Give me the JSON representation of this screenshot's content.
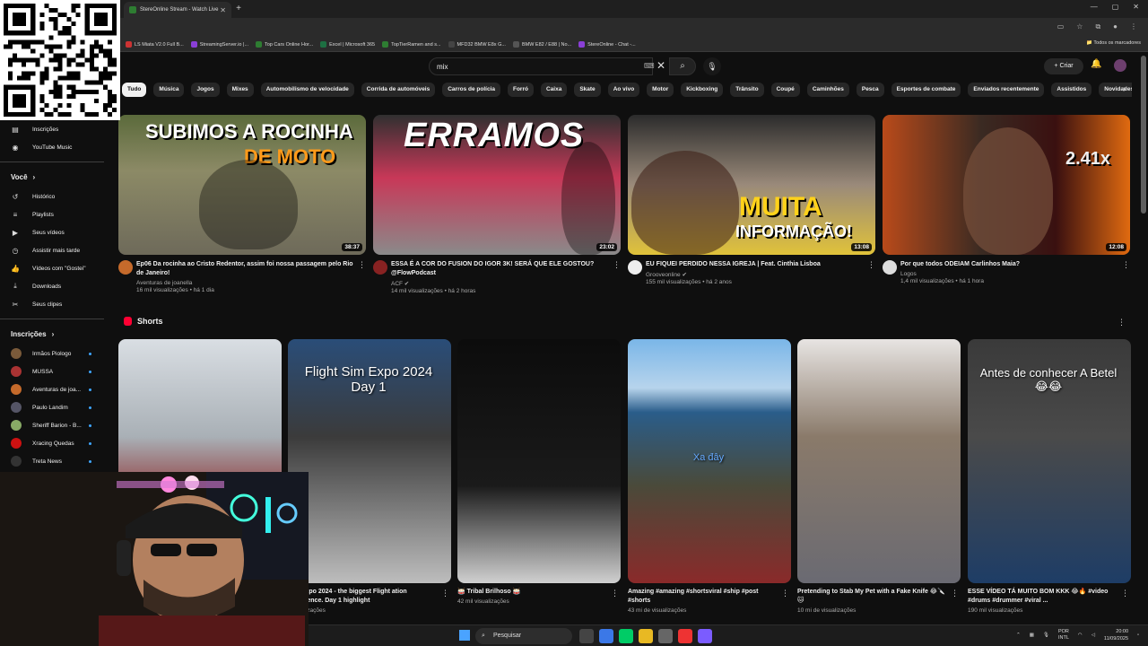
{
  "browser": {
    "tab_title": "StereOnline Stream - Watch Live",
    "bookmarks": [
      "LS Miata V2.0 Full B...",
      "StreamingServer.io |...",
      "Top Cars Online Hor...",
      "Excel | Microsoft 365",
      "TopTierRamen and s...",
      "MFD32 BMW E8x G...",
      "BMW E82 / E88 | No...",
      "StereOnline - Chat -..."
    ],
    "bookmarks_folder": "Todos os marcadores"
  },
  "header": {
    "search_value": "mix",
    "create_label": "Criar"
  },
  "chips": [
    "Tudo",
    "Música",
    "Jogos",
    "Mixes",
    "Automobilismo de velocidade",
    "Corrida de automóveis",
    "Carros de polícia",
    "Forró",
    "Caixa",
    "Skate",
    "Ao vivo",
    "Motor",
    "Kickboxing",
    "Trânsito",
    "Coupé",
    "Caminhões",
    "Pesca",
    "Esportes de combate",
    "Enviados recentemente",
    "Assistidos",
    "Novidades para vo"
  ],
  "sidebar": {
    "top": [
      {
        "icon": "subscriptions-icon",
        "label": "Inscrições"
      },
      {
        "icon": "youtube-music-icon",
        "label": "YouTube Music"
      }
    ],
    "you_heading": "Você",
    "you_items": [
      {
        "icon": "history-icon",
        "label": "Histórico"
      },
      {
        "icon": "playlists-icon",
        "label": "Playlists"
      },
      {
        "icon": "your-videos-icon",
        "label": "Seus vídeos"
      },
      {
        "icon": "watch-later-icon",
        "label": "Assistir mais tarde"
      },
      {
        "icon": "liked-videos-icon",
        "label": "Vídeos com \"Gostei\""
      },
      {
        "icon": "downloads-icon",
        "label": "Downloads"
      },
      {
        "icon": "clips-icon",
        "label": "Seus clipes"
      }
    ],
    "subs_heading": "Inscrições",
    "subs": [
      {
        "label": "Irmãos Piologo",
        "color": "#7a5a3a"
      },
      {
        "label": "MUSSA",
        "color": "#a33"
      },
      {
        "label": "Aventuras de joa...",
        "color": "#c56a2b"
      },
      {
        "label": "Paulo Landim",
        "color": "#556"
      },
      {
        "label": "Sheriff Barion - B...",
        "color": "#8a6"
      },
      {
        "label": "Xracing Quedas",
        "color": "#c11"
      },
      {
        "label": "Treta News",
        "color": "#333"
      }
    ]
  },
  "videos": [
    {
      "thumb_text": "SUBIMOS A ROCINHA",
      "thumb_text2": "DE MOTO",
      "duration": "38:37",
      "title": "Ep06 Da rocinha ao Cristo Redentor, assim foi nossa passagem pelo Rio de Janeiro!",
      "channel": "Aventuras de joanella",
      "stats": "16 mil visualizações • há 1 dia",
      "avatar": "#c56a2b"
    },
    {
      "thumb_text": "ERRAMOS",
      "thumb_text2": "",
      "duration": "23:02",
      "title": "ESSA É A COR DO FUSION DO IGOR 3K! SERÁ QUE ELE GOSTOU? @FlowPodcast",
      "channel": "ACF ✔",
      "stats": "14 mil visualizações • há 2 horas",
      "avatar": "#822"
    },
    {
      "thumb_text": "MUITA",
      "thumb_text2": "INFORMAÇÃO!",
      "duration": "13:08",
      "title": "EU FIQUEI PERDIDO NESSA IGREJA | Feat. Cinthia Lisboa",
      "channel": "Grooveonline ✔",
      "stats": "155 mil visualizações • há 2 anos",
      "avatar": "#eee"
    },
    {
      "thumb_text": "2.41x",
      "thumb_text2": "",
      "duration": "12:08",
      "title": "Por que todos ODEIAM Carlinhos Maia?",
      "channel": "Logos",
      "stats": "1,4 mil visualizações • há 1 hora",
      "avatar": "#ddd"
    }
  ],
  "shorts_heading": "Shorts",
  "shorts": [
    {
      "thumb_text": "",
      "title": "",
      "stats": ""
    },
    {
      "thumb_text": "Flight Sim Expo 2024 Day 1",
      "title": "Sim Expo 2024 - the biggest Flight ation conference. Day 1 highlight",
      "stats": "i visualizações"
    },
    {
      "thumb_text": "",
      "title": "🥁 Tribal Brilhoso 🥁",
      "stats": "42 mil visualizações"
    },
    {
      "thumb_text": "Xa đây",
      "title": "Amazing #amazing #shortsviral #ship #post #shorts",
      "stats": "43 mi de visualizações"
    },
    {
      "thumb_text": "",
      "title": "Pretending to Stab My Pet with a Fake Knife 😂🔪🐱",
      "stats": "10 mi de visualizações"
    },
    {
      "thumb_text": "Antes de conhecer A Betel 😂😂",
      "title": "ESSE VÍDEO TÁ MUITO BOM KKK 😂🔥 #video #drums #drummer #viral ...",
      "stats": "190 mil visualizações"
    }
  ],
  "taskbar": {
    "search_label": "Pesquisar",
    "lang_top": "POR",
    "lang_bottom": "INTL",
    "time": "20:00",
    "date": "11/09/2025"
  }
}
